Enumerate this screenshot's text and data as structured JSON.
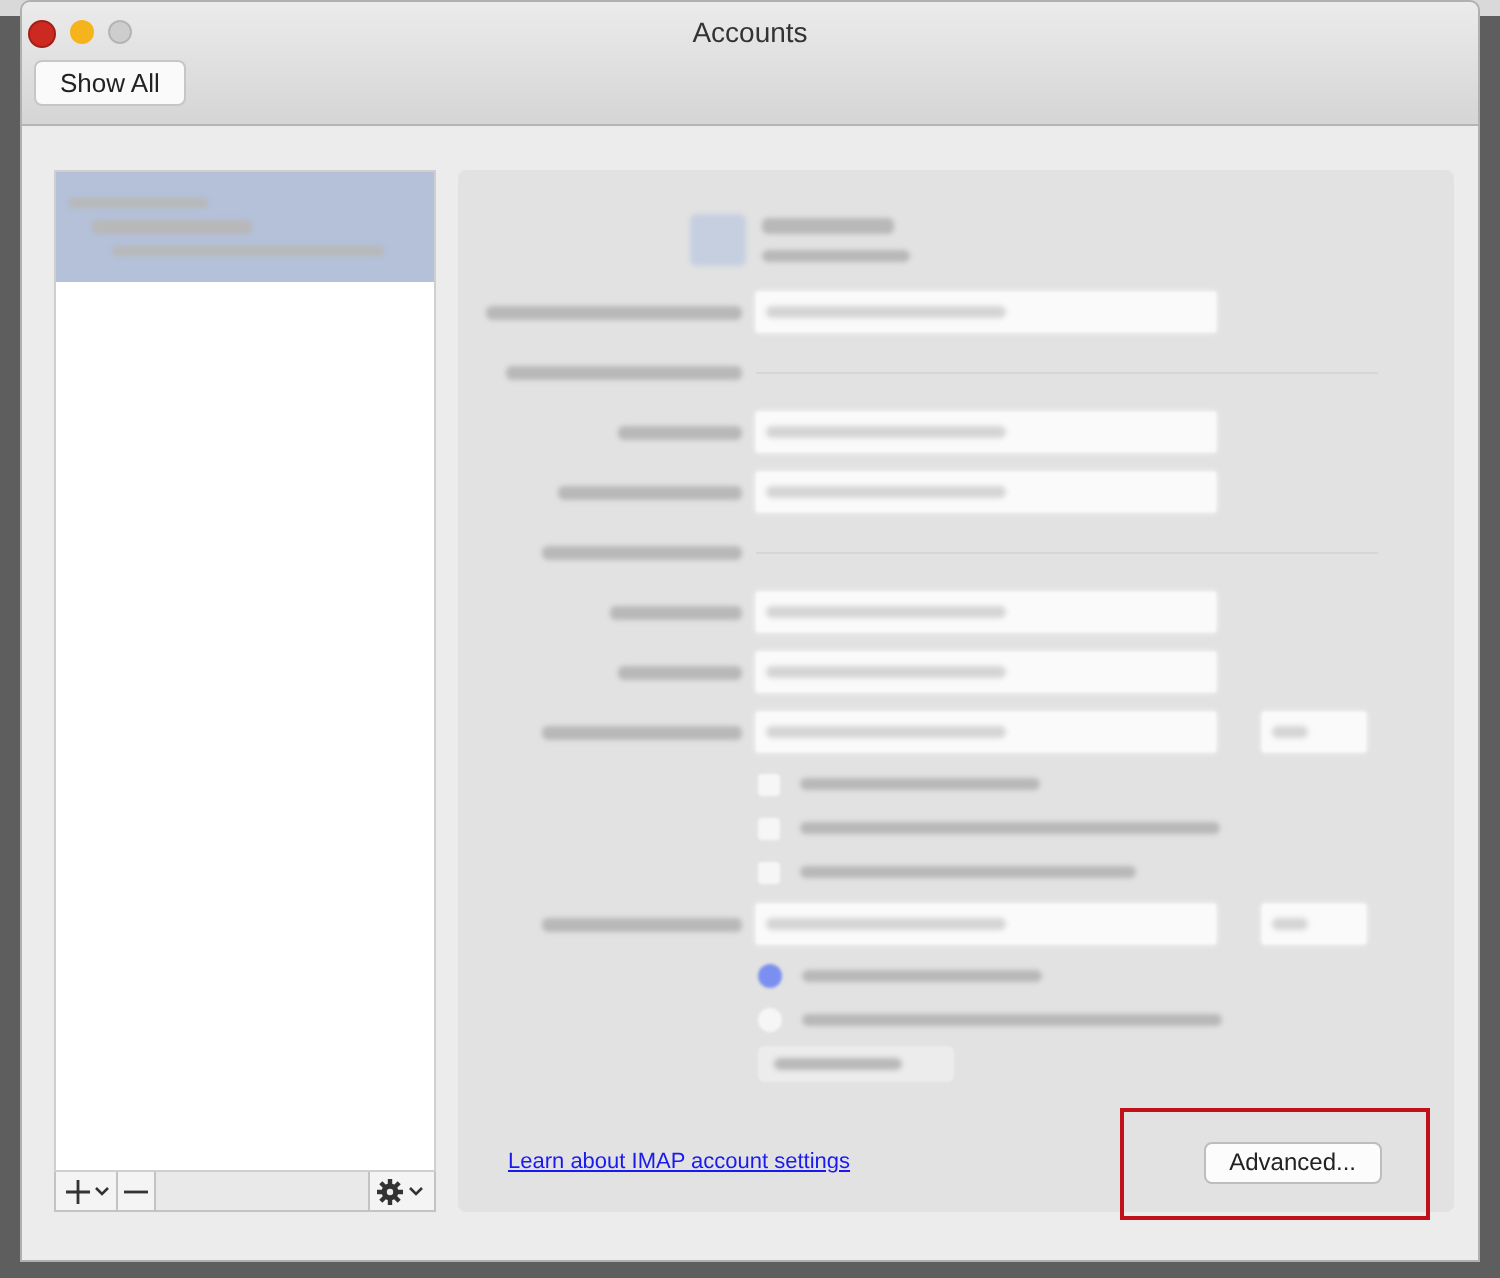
{
  "window": {
    "title": "Accounts"
  },
  "toolbar": {
    "show_all": "Show All"
  },
  "account_list": {
    "items": [
      {
        "selected": true
      }
    ]
  },
  "incoming_options": [
    {
      "checked": false
    },
    {
      "checked": false
    },
    {
      "checked": false
    }
  ],
  "outgoing_options": [
    {
      "selected": true
    },
    {
      "selected": false
    }
  ],
  "help_link": "Learn about IMAP account settings",
  "advanced_button": {
    "label": "Advanced...",
    "highlighted": true
  }
}
